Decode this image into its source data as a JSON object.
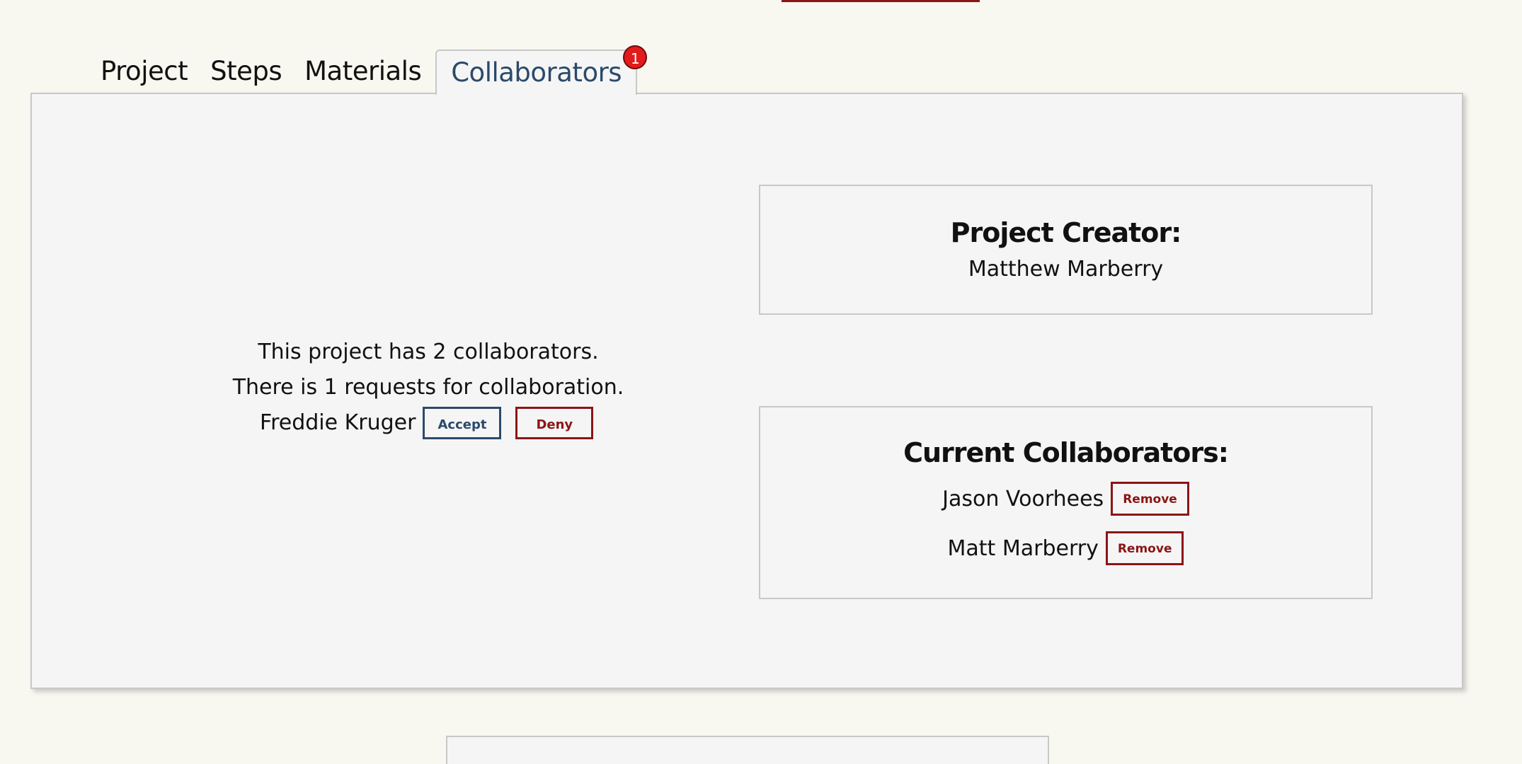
{
  "tabs": [
    {
      "label": "Project",
      "active": false
    },
    {
      "label": "Steps",
      "active": false
    },
    {
      "label": "Materials",
      "active": false
    },
    {
      "label": "Collaborators",
      "active": true,
      "badge": "1"
    }
  ],
  "summary": {
    "collaborators_text": "This project has 2 collaborators.",
    "requests_text": "There is 1 requests for collaboration."
  },
  "requests": [
    {
      "name": "Freddie Kruger",
      "accept_label": "Accept",
      "deny_label": "Deny"
    }
  ],
  "creator": {
    "title": "Project Creator:",
    "name": "Matthew Marberry"
  },
  "collaborators": {
    "title": "Current Collaborators:",
    "items": [
      {
        "name": "Jason Voorhees",
        "remove_label": "Remove"
      },
      {
        "name": "Matt Marberry",
        "remove_label": "Remove"
      }
    ]
  },
  "colors": {
    "accent_blue": "#2b4a6b",
    "accent_red": "#8b1515",
    "badge_red": "#e41b1b",
    "page_bg": "#f8f7f0",
    "panel_bg": "#f5f5f5"
  }
}
